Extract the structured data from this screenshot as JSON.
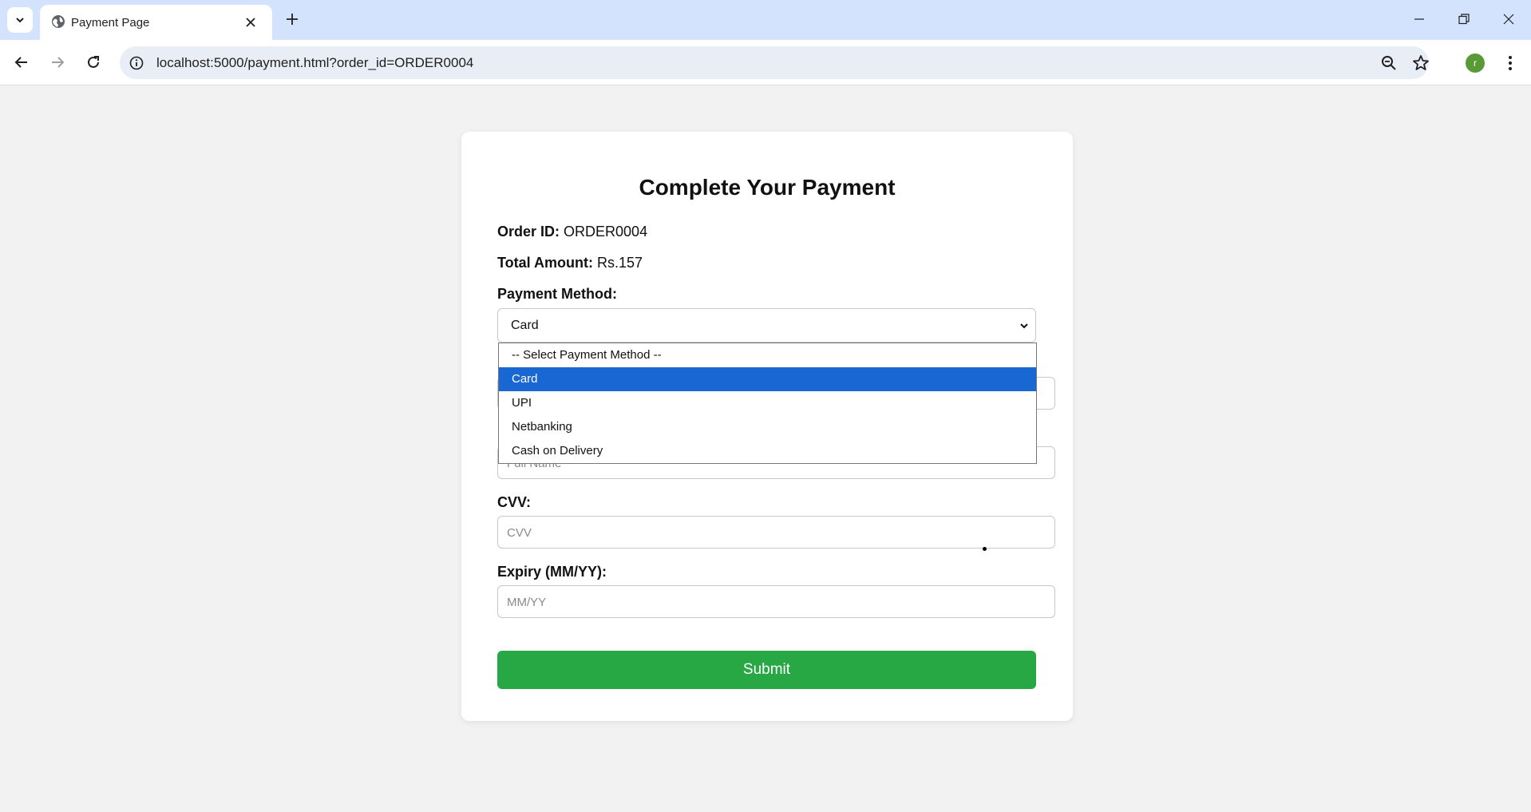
{
  "browser": {
    "tab_title": "Payment Page",
    "url": "localhost:5000/payment.html?order_id=ORDER0004",
    "profile_initial": "r",
    "profile_color": "#5a9a36"
  },
  "page": {
    "title": "Complete Your Payment",
    "order_id_label": "Order ID:",
    "order_id_value": "ORDER0004",
    "amount_label": "Total Amount:",
    "amount_value": "Rs.157",
    "payment_method_label": "Payment Method:",
    "payment_method_selected": "Card",
    "payment_options": [
      "-- Select Payment Method --",
      "Card",
      "UPI",
      "Netbanking",
      "Cash on Delivery"
    ],
    "name_placeholder": "Full Name",
    "cvv_label": "CVV:",
    "cvv_placeholder": "CVV",
    "expiry_label": "Expiry (MM/YY):",
    "expiry_placeholder": "MM/YY",
    "submit_label": "Submit",
    "submit_color": "#28a745",
    "selected_option_color": "#1967d2"
  }
}
